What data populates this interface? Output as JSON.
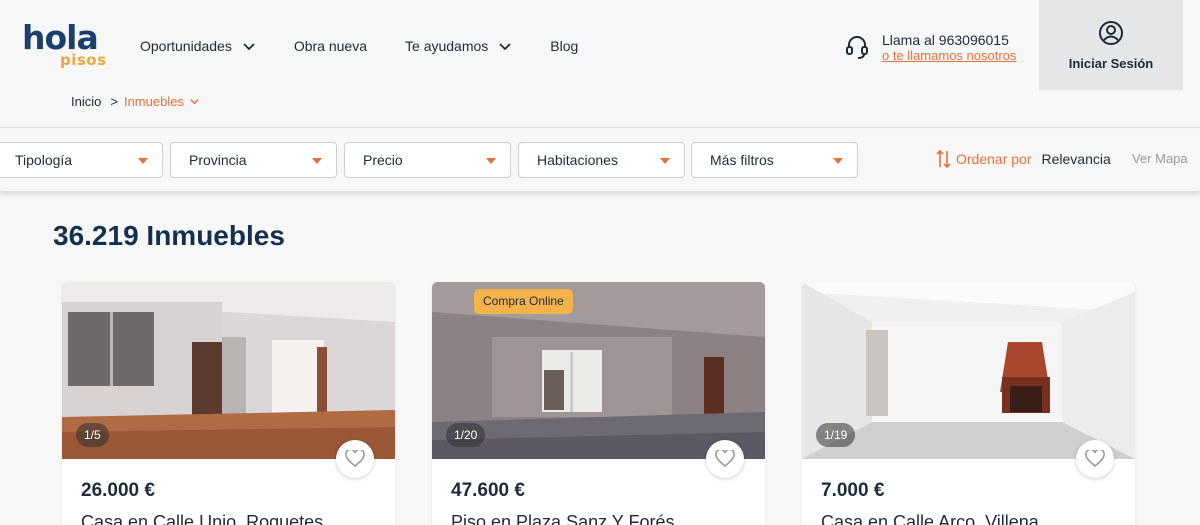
{
  "header": {
    "logo": {
      "word": "hola",
      "sub": "pisos"
    },
    "nav": [
      {
        "label": "Oportunidades",
        "has_dropdown": true
      },
      {
        "label": "Obra nueva",
        "has_dropdown": false
      },
      {
        "label": "Te ayudamos",
        "has_dropdown": true
      },
      {
        "label": "Blog",
        "has_dropdown": false
      }
    ],
    "phone": {
      "icon": "headset-icon",
      "call_text": "Llama al 963096015",
      "callback_link": "o te llamamos nosotros"
    },
    "login": {
      "icon": "user-circle-icon",
      "label": "Iniciar Sesión"
    }
  },
  "breadcrumb": {
    "home": "Inicio",
    "separator": ">",
    "current": "Inmuebles"
  },
  "filters": {
    "dropdowns": [
      {
        "label": "Tipología"
      },
      {
        "label": "Provincia"
      },
      {
        "label": "Precio"
      },
      {
        "label": "Habitaciones"
      },
      {
        "label": "Más filtros"
      }
    ],
    "sort": {
      "icon": "sort-arrows-icon",
      "label": "Ordenar por",
      "value": "Relevancia"
    },
    "map_link": "Ver Mapa"
  },
  "results": {
    "title": "36.219 Inmuebles",
    "cards": [
      {
        "counter": "1/5",
        "badge": "",
        "price": "26.000 €",
        "address": "Casa en Calle Unio, Roquetes"
      },
      {
        "counter": "1/20",
        "badge": "Compra Online",
        "price": "47.600 €",
        "address": "Piso en Plaza Sanz Y Forés"
      },
      {
        "counter": "1/19",
        "badge": "",
        "price": "7.000 €",
        "address": "Casa en Calle Arco, Villena"
      }
    ]
  },
  "colors": {
    "accent": "#e4703a",
    "brand_blue": "#1c3f6e",
    "brand_yellow": "#f0a53a",
    "badge": "#f3b24a"
  }
}
